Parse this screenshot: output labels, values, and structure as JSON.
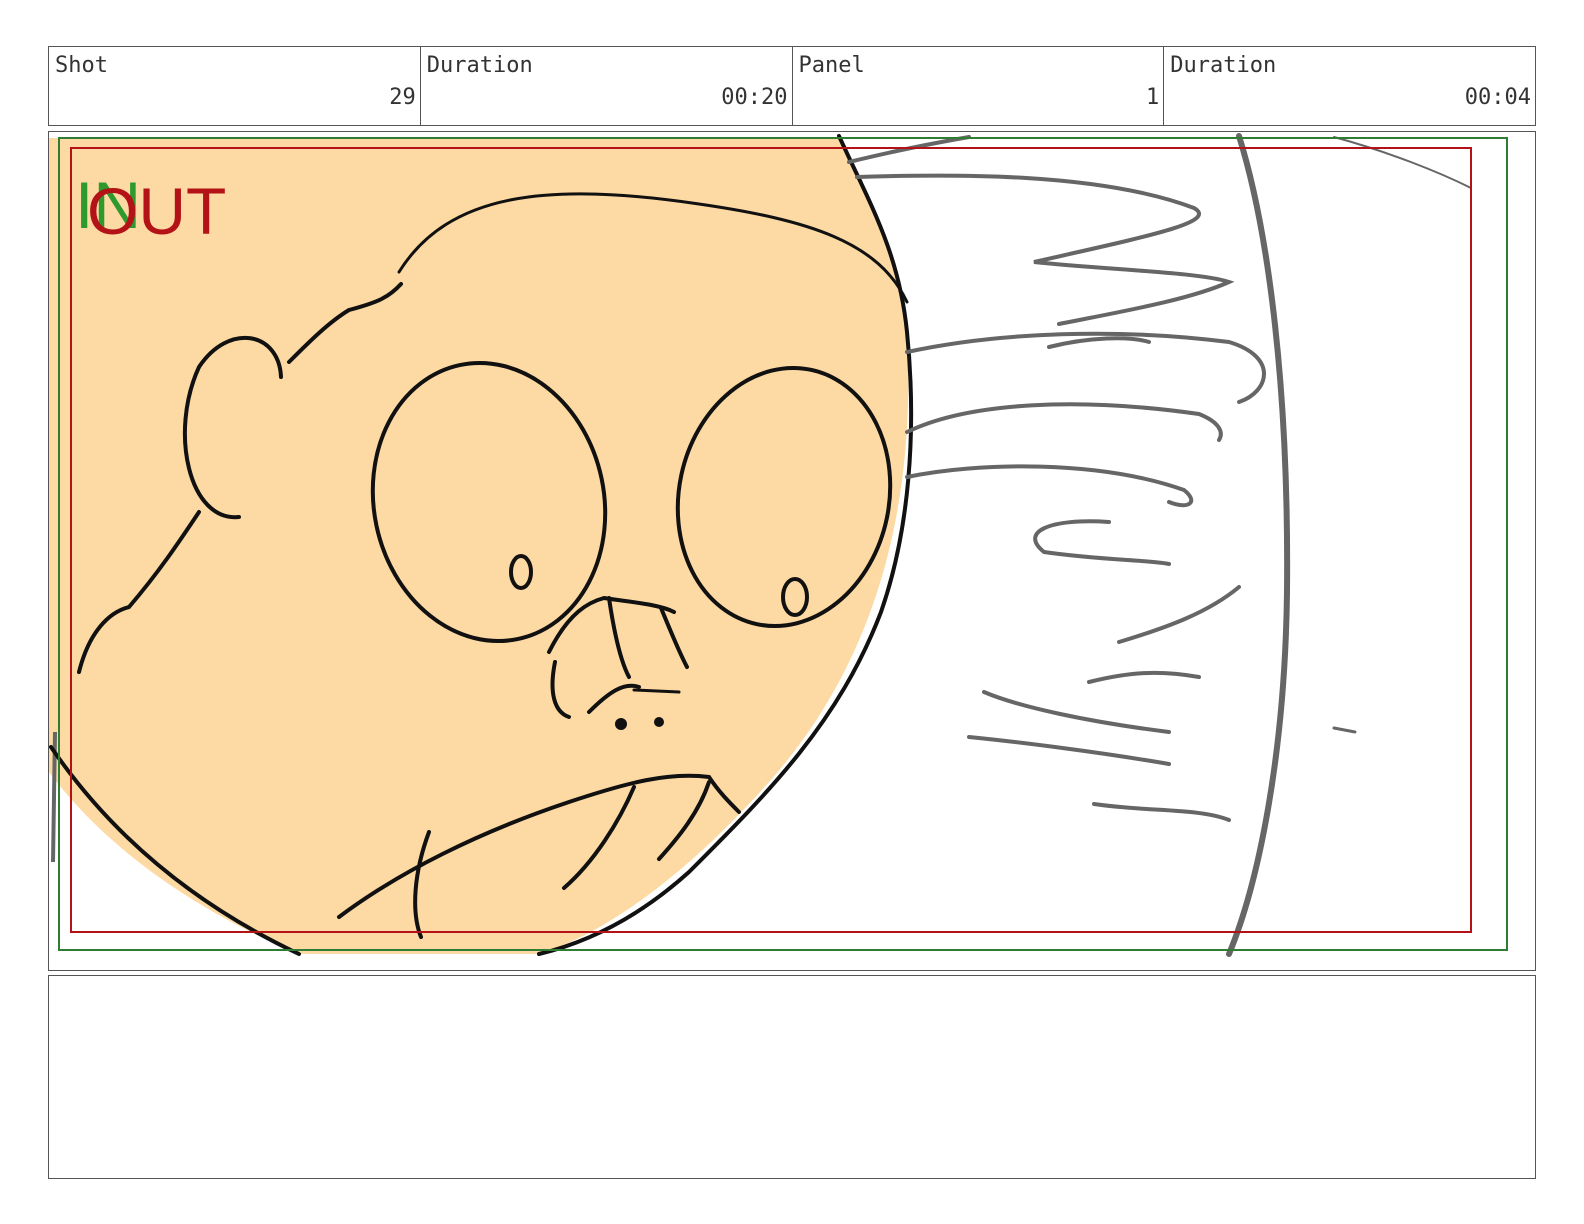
{
  "header": {
    "shot_label": "Shot",
    "shot_value": "29",
    "shot_duration_label": "Duration",
    "shot_duration_value": "00:20",
    "panel_label": "Panel",
    "panel_value": "1",
    "panel_duration_label": "Duration",
    "panel_duration_value": "00:04"
  },
  "panel": {
    "in_marker": "IN",
    "out_marker": "OUT"
  },
  "colors": {
    "skin": "#fdd9a3",
    "in_green": "#2e9a2e",
    "out_red": "#b31217",
    "safe_frame_red": "#b31217",
    "safe_frame_green": "#2e7d32"
  },
  "notes": {
    "text": ""
  }
}
